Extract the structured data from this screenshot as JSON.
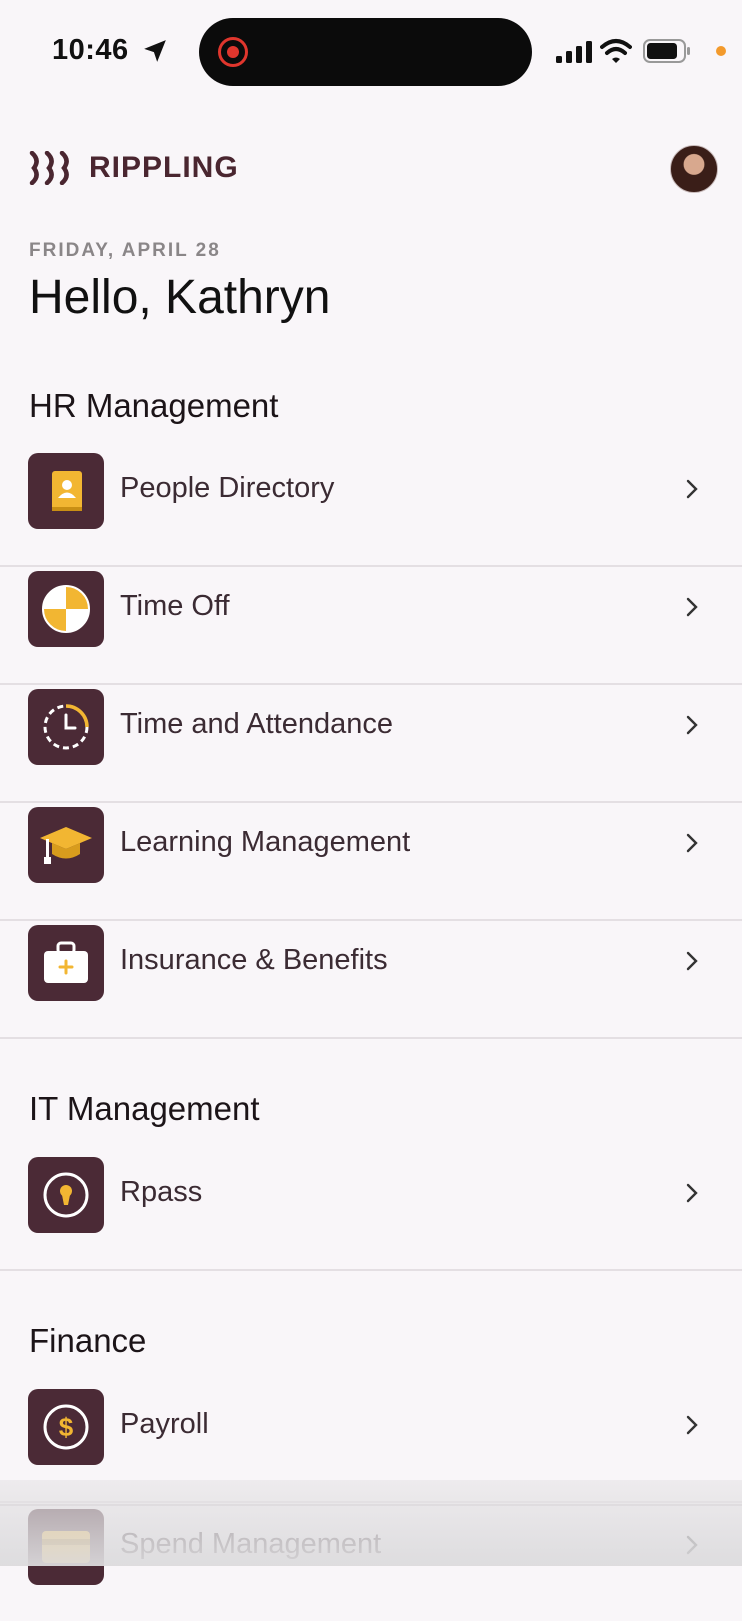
{
  "status_bar": {
    "time": "10:46",
    "icons": [
      "location-arrow-icon",
      "screen-recording-icon",
      "signal-bars-icon",
      "wifi-icon",
      "battery-icon",
      "privacy-dot-icon"
    ]
  },
  "header": {
    "logo_text": "RIPPLING",
    "logo_icon": "rippling-logo-mark",
    "avatar_icon": "user-avatar"
  },
  "greeting": {
    "date": "FRIDAY, APRIL 28",
    "text": "Hello, Kathryn"
  },
  "colors": {
    "tile_bg": "#4b2a36",
    "accent_gold": "#f2b632",
    "background": "#f9f6f9"
  },
  "sections": [
    {
      "title": "HR Management",
      "items": [
        {
          "label": "People Directory",
          "icon": "directory-book-icon"
        },
        {
          "label": "Time Off",
          "icon": "beach-ball-icon"
        },
        {
          "label": "Time and Attendance",
          "icon": "clock-icon"
        },
        {
          "label": "Learning Management",
          "icon": "graduation-cap-icon"
        },
        {
          "label": "Insurance & Benefits",
          "icon": "medical-bag-icon"
        }
      ]
    },
    {
      "title": "IT Management",
      "items": [
        {
          "label": "Rpass",
          "icon": "keyhole-icon"
        }
      ]
    },
    {
      "title": "Finance",
      "items": [
        {
          "label": "Payroll",
          "icon": "dollar-coin-icon"
        },
        {
          "label": "Spend Management",
          "icon": "credit-card-icon"
        }
      ]
    }
  ]
}
